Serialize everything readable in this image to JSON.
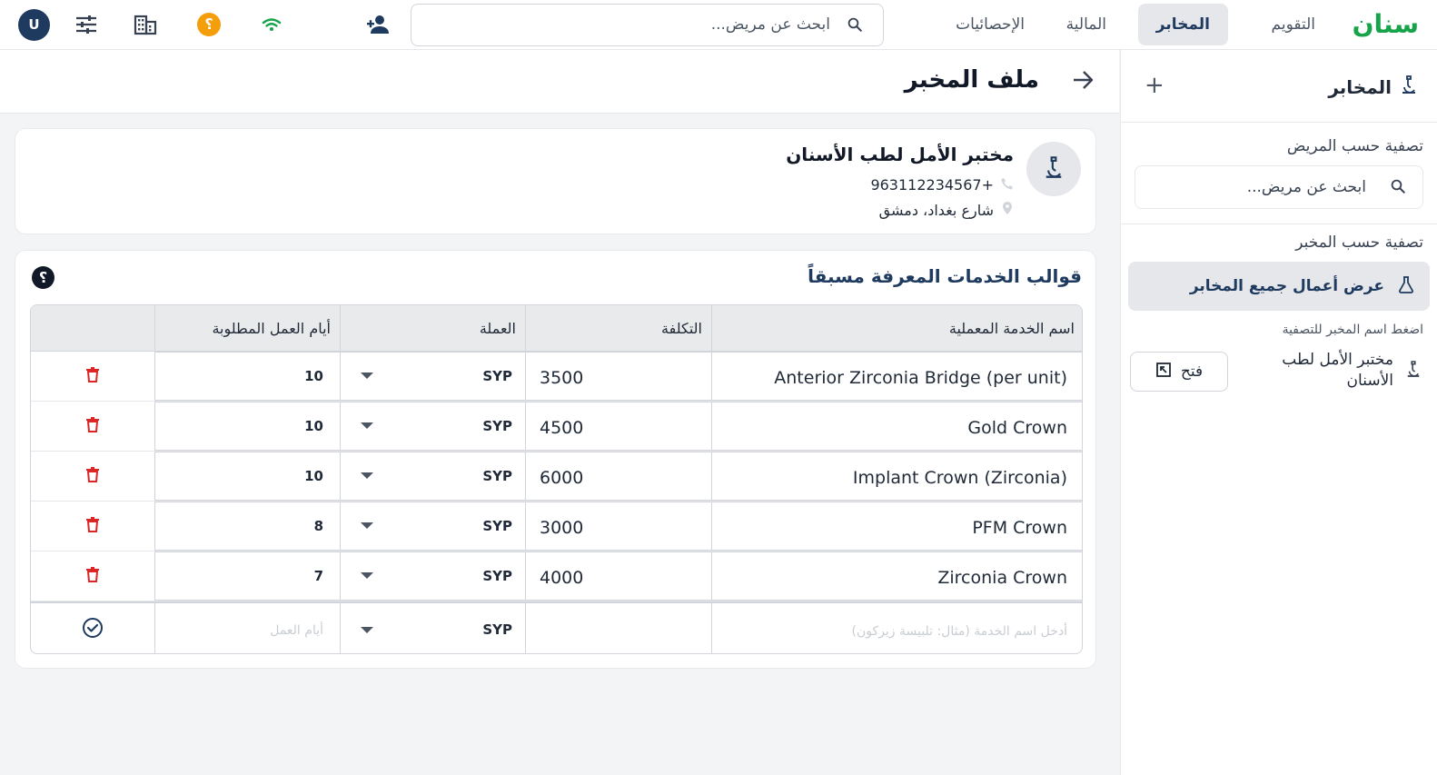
{
  "brand": "سنان",
  "nav": {
    "tabs": [
      {
        "label": "التقويم",
        "active": false
      },
      {
        "label": "المخابر",
        "active": true
      },
      {
        "label": "المالية",
        "active": false
      },
      {
        "label": "الإحصائيات",
        "active": false
      }
    ],
    "search_placeholder": "ابحث عن مريض..."
  },
  "topbar_icons": [
    "add-person-icon",
    "wifi-icon",
    "coin-icon",
    "building-icon",
    "sliders-icon"
  ],
  "user": {
    "initial": "U"
  },
  "coin_symbol": "؟",
  "sidebar": {
    "title": "المخابر",
    "add_symbol": "+",
    "filter_patient_label": "تصفية حسب المريض",
    "search_placeholder": "ابحث عن مريض...",
    "filter_lab_label": "تصفية حسب المخبر",
    "show_all": "عرض أعمال جميع المخابر",
    "hint": "اضغط اسم المخبر للتصفية",
    "labs": [
      {
        "name": "مختبر الأمل لطب الأسنان",
        "open_label": "فتح"
      }
    ]
  },
  "page": {
    "title": "ملف المخبر"
  },
  "lab": {
    "name": "مختبر الأمل لطب الأسنان",
    "phone": "963112234567+",
    "address": "شارع بغداد، دمشق"
  },
  "services": {
    "title": "قوالب الخدمات المعرفة مسبقاً",
    "help_symbol": "؟",
    "columns": {
      "name": "اسم الخدمة المعملية",
      "cost": "التكلفة",
      "currency": "العملة",
      "days": "أيام العمل المطلوبة"
    },
    "rows": [
      {
        "name": "Anterior Zirconia Bridge (per unit)",
        "cost": "3500",
        "currency": "SYP",
        "days": "10"
      },
      {
        "name": "Gold Crown",
        "cost": "4500",
        "currency": "SYP",
        "days": "10"
      },
      {
        "name": "Implant Crown (Zirconia)",
        "cost": "6000",
        "currency": "SYP",
        "days": "10"
      },
      {
        "name": "PFM Crown",
        "cost": "3000",
        "currency": "SYP",
        "days": "8"
      },
      {
        "name": "Zirconia Crown",
        "cost": "4000",
        "currency": "SYP",
        "days": "7"
      }
    ],
    "new_row": {
      "name_placeholder": "أدخل اسم الخدمة (مثال: تلبيسة زيركون)",
      "cost": "",
      "currency": "SYP",
      "days_placeholder": "أيام العمل"
    }
  },
  "colors": {
    "brand": "#16a34a",
    "navy": "#1e3a5f",
    "danger": "#dc2626",
    "coin": "#f59e0b",
    "wifi": "#16a34a"
  }
}
